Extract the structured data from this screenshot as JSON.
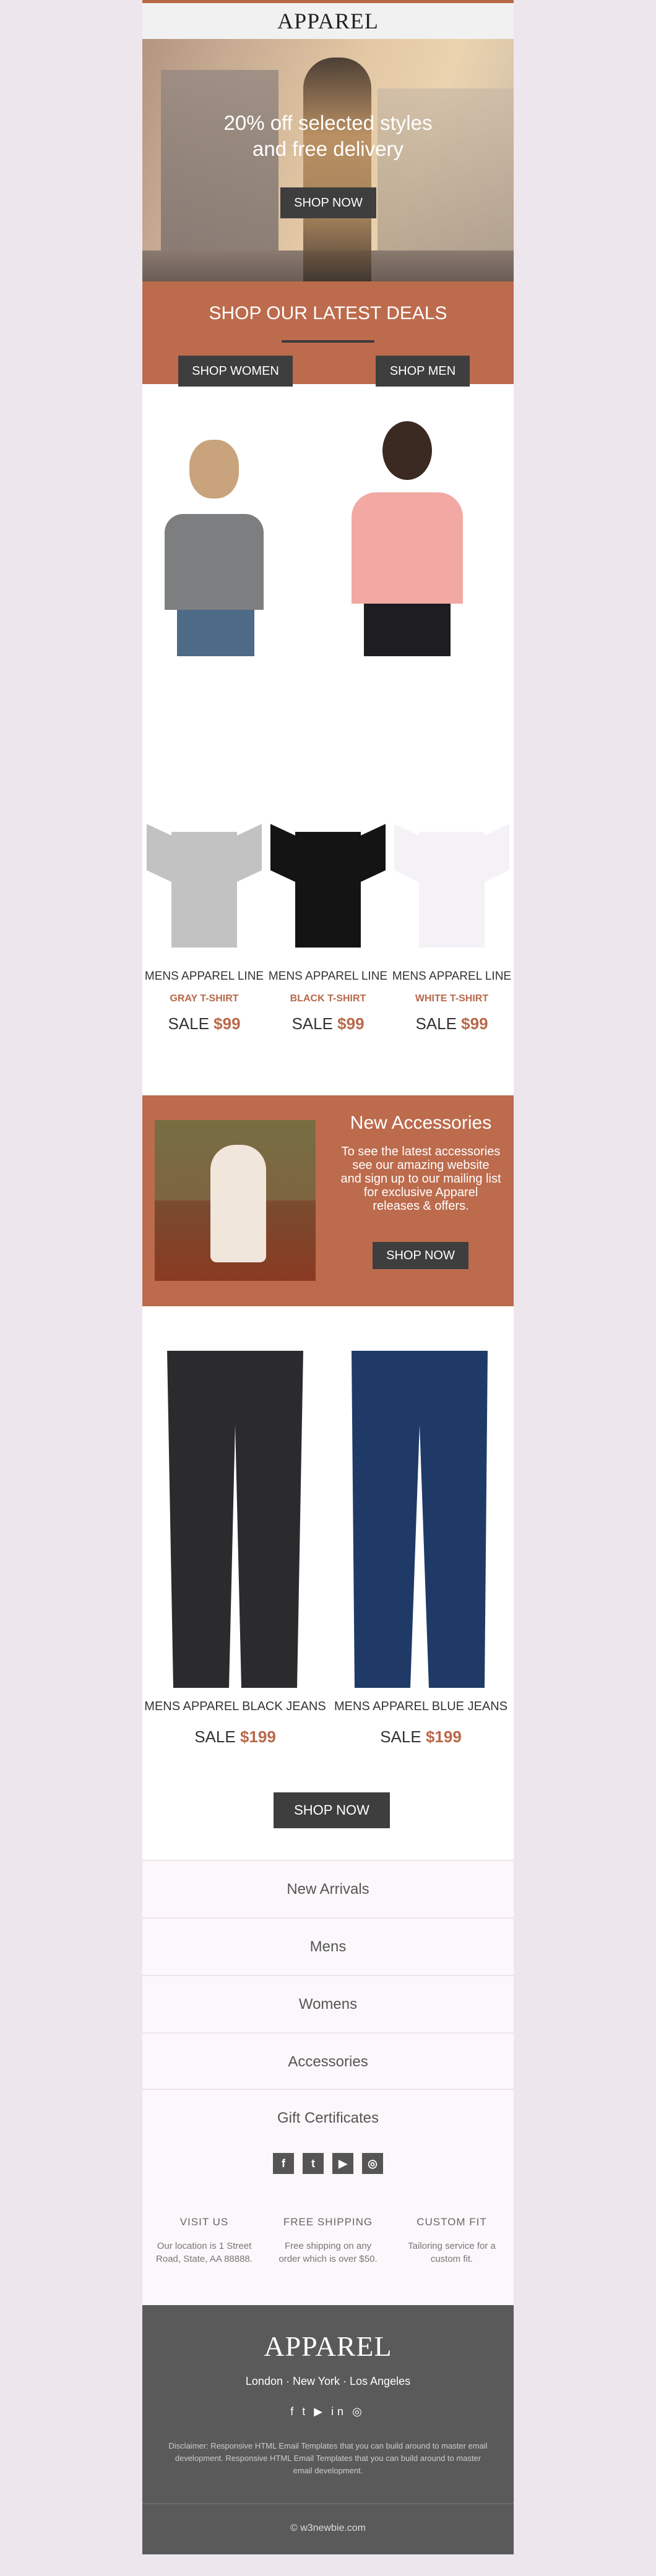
{
  "brand": "APPAREL",
  "hero": {
    "headline_line1": "20% off selected styles",
    "headline_line2": "and free delivery",
    "cta": "SHOP NOW"
  },
  "deals": {
    "title": "SHOP OUR LATEST DEALS"
  },
  "categories": {
    "women_button": "SHOP WOMEN",
    "men_button": "SHOP MEN"
  },
  "products": [
    {
      "name": "MENS APPAREL LINE",
      "color_label": "GRAY T-SHIRT",
      "sale_label": "SALE",
      "price": "$99",
      "swatch": "#c2c2c2"
    },
    {
      "name": "MENS APPAREL LINE",
      "color_label": "BLACK T-SHIRT",
      "sale_label": "SALE",
      "price": "$99",
      "swatch": "#141414"
    },
    {
      "name": "MENS APPAREL LINE",
      "color_label": "WHITE T-SHIRT",
      "sale_label": "SALE",
      "price": "$99",
      "swatch": "#f4f2f6"
    }
  ],
  "accessories": {
    "title": "New Accessories",
    "body": "To see the latest accessories see our amazing website and sign up to our mailing list for exclusive Apparel releases & offers.",
    "cta": "SHOP NOW"
  },
  "jeans": [
    {
      "name": "MENS APPAREL BLACK JEANS",
      "sale_label": "SALE",
      "price": "$199",
      "swatch": "#2b2b2e"
    },
    {
      "name": "MENS APPAREL BLUE JEANS",
      "sale_label": "SALE",
      "price": "$199",
      "swatch": "#1f3a66"
    }
  ],
  "jeans_cta": "SHOP NOW",
  "nav": [
    "New Arrivals",
    "Mens",
    "Womens",
    "Accessories",
    "Gift Certificates"
  ],
  "social_icons": [
    "facebook-icon",
    "twitter-icon",
    "youtube-icon",
    "instagram-icon"
  ],
  "info": [
    {
      "heading": "VISIT US",
      "text": "Our location is 1 Street Road, State, AA 88888."
    },
    {
      "heading": "FREE SHIPPING",
      "text": "Free shipping on any order which is over $50."
    },
    {
      "heading": "CUSTOM FIT",
      "text": "Tailoring service for a custom fit."
    }
  ],
  "footer": {
    "brand": "APPAREL",
    "cities": "London · New York · Los Angeles",
    "disclaimer": "Disclaimer: Responsive HTML Email Templates that you can build around to master email development. Responsive HTML Email Templates that you can build around to master email development.",
    "copyright": "© w3newbie.com"
  },
  "colors": {
    "accent": "#bd6b4d",
    "dark_button": "#3e3e3e",
    "footer_bg": "#5a5a5a",
    "page_bg": "#ede6ec"
  }
}
